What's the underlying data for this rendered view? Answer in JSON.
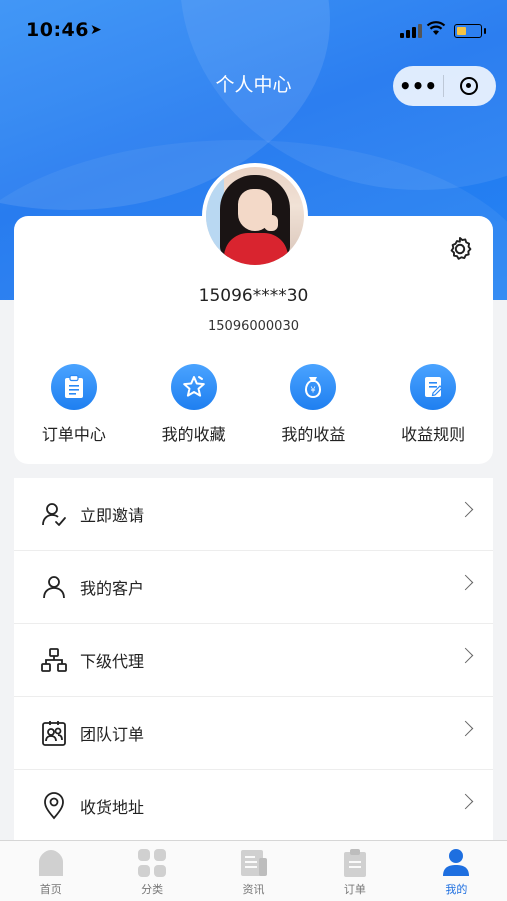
{
  "status_bar": {
    "time": "10:46"
  },
  "navbar": {
    "title": "个人中心"
  },
  "profile": {
    "username": "15096****30",
    "phone": "15096000030"
  },
  "shortcuts": [
    {
      "label": "订单中心",
      "icon": "clipboard-icon"
    },
    {
      "label": "我的收藏",
      "icon": "star-icon"
    },
    {
      "label": "我的收益",
      "icon": "money-bag-icon"
    },
    {
      "label": "收益规则",
      "icon": "document-icon"
    }
  ],
  "menu": [
    {
      "label": "立即邀请",
      "icon": "user-check-icon"
    },
    {
      "label": "我的客户",
      "icon": "user-icon"
    },
    {
      "label": "下级代理",
      "icon": "hierarchy-icon"
    },
    {
      "label": "团队订单",
      "icon": "team-badge-icon"
    },
    {
      "label": "收货地址",
      "icon": "location-pin-icon"
    }
  ],
  "tabbar": [
    {
      "label": "首页",
      "icon": "home-icon"
    },
    {
      "label": "分类",
      "icon": "grid-icon"
    },
    {
      "label": "资讯",
      "icon": "news-icon"
    },
    {
      "label": "订单",
      "icon": "order-icon"
    },
    {
      "label": "我的",
      "icon": "profile-icon",
      "active": true
    }
  ],
  "colors": {
    "accent": "#1f7ff0",
    "tab_active": "#1e6fe0"
  }
}
